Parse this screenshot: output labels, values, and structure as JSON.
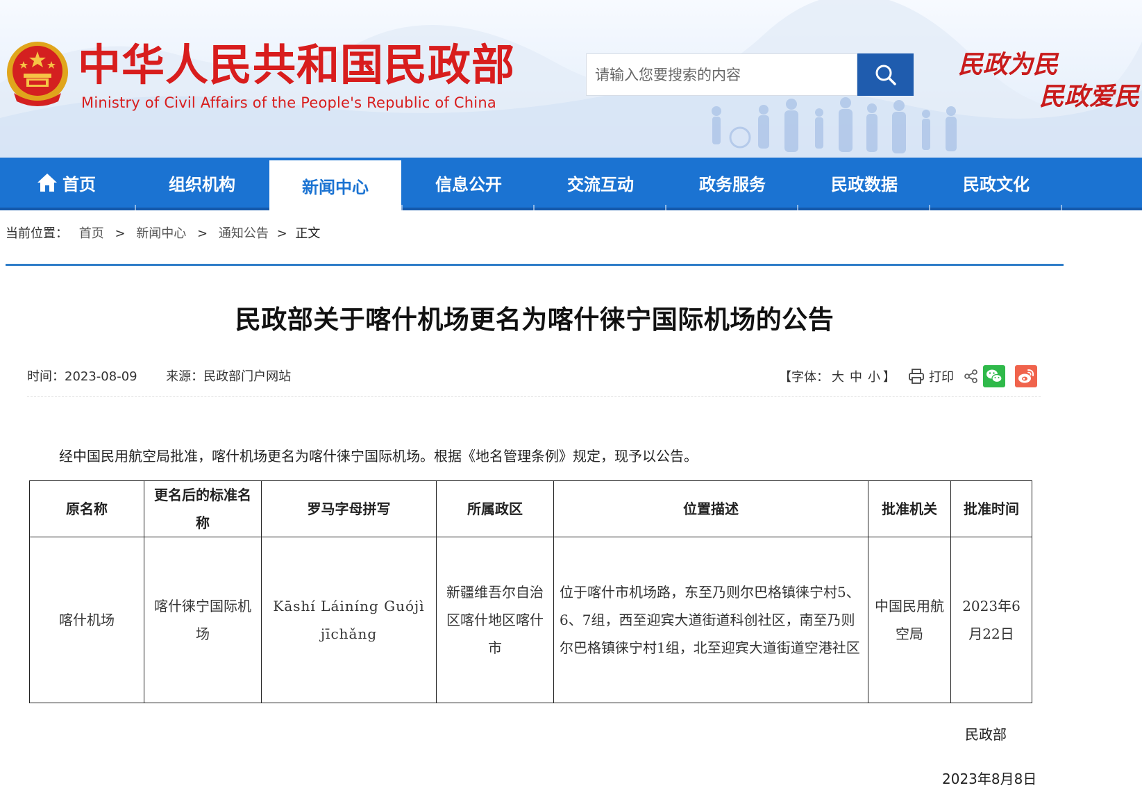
{
  "header": {
    "title_cn": "中华人民共和国民政部",
    "title_en": "Ministry of Civil Affairs of the People's Republic of China",
    "search_placeholder": "请输入您要搜索的内容",
    "slogan_line1": "民政为民",
    "slogan_line2": "民政爱民"
  },
  "nav": {
    "items": [
      "首页",
      "组织机构",
      "新闻中心",
      "信息公开",
      "交流互动",
      "政务服务",
      "民政数据",
      "民政文化"
    ],
    "active_index": 2
  },
  "breadcrumb": {
    "label": "当前位置：",
    "items": [
      "首页",
      "新闻中心",
      "通知公告",
      "正文"
    ],
    "separator": ">"
  },
  "article": {
    "title": "民政部关于喀什机场更名为喀什徕宁国际机场的公告",
    "time_label": "时间：",
    "time": "2023-08-09",
    "source_label": "来源：",
    "source": "民政部门户网站",
    "font_label": "【字体：",
    "font_sizes": [
      "大",
      "中",
      "小"
    ],
    "font_close": "】",
    "print_label": "打印",
    "paragraph": "经中国民用航空局批准，喀什机场更名为喀什徕宁国际机场。根据《地名管理条例》规定，现予以公告。",
    "signature": "民政部",
    "date": "2023年8月8日"
  },
  "table": {
    "headers": [
      "原名称",
      "更名后的标准名称",
      "罗马字母拼写",
      "所属政区",
      "位置描述",
      "批准机关",
      "批准时间"
    ],
    "row": {
      "old_name": "喀什机场",
      "new_name": "喀什徕宁国际机场",
      "romanization": "Kāshí Láiníng Guójì jīchǎng",
      "region": "新疆维吾尔自治区喀什地区喀什市",
      "location": "位于喀什市机场路，东至乃则尔巴格镇徕宁村5、6、7组，西至迎宾大道街道科创社区，南至乃则尔巴格镇徕宁村1组，北至迎宾大道街道空港社区",
      "authority": "中国民用航空局",
      "approval_date": "2023年6月22日"
    }
  },
  "colors": {
    "brand_red": "#d81d1d",
    "nav_blue": "#1b73d2",
    "search_blue": "#1f5cae",
    "rule_blue": "#2f7dc8"
  }
}
